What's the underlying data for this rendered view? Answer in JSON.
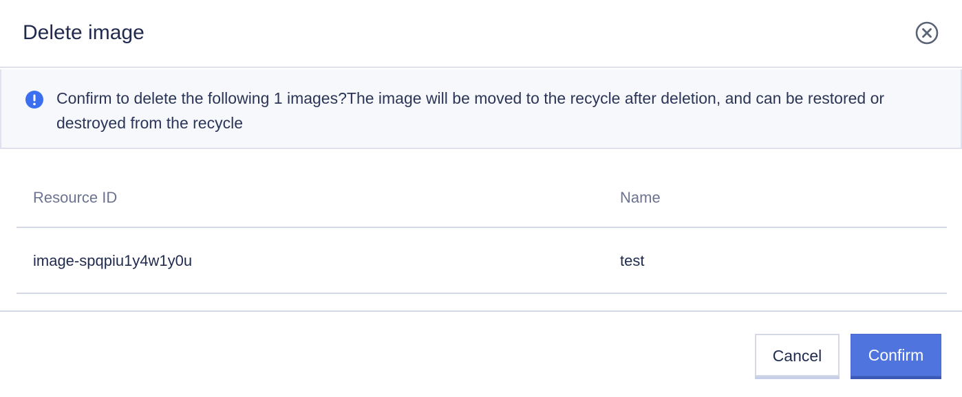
{
  "dialog": {
    "title": "Delete image",
    "close_icon": "close-circle-icon"
  },
  "alert": {
    "icon": "info-exclamation-icon",
    "accent_color": "#3b6ff0",
    "message": "Confirm to delete the following 1 images?The image will be moved to the recycle after deletion, and can be restored or destroyed from the recycle"
  },
  "table": {
    "columns": [
      "Resource ID",
      "Name"
    ],
    "rows": [
      [
        "image-spqpiu1y4w1y0u",
        "test"
      ]
    ]
  },
  "footer": {
    "cancel_label": "Cancel",
    "confirm_label": "Confirm",
    "confirm_color": "#4f74dd"
  }
}
